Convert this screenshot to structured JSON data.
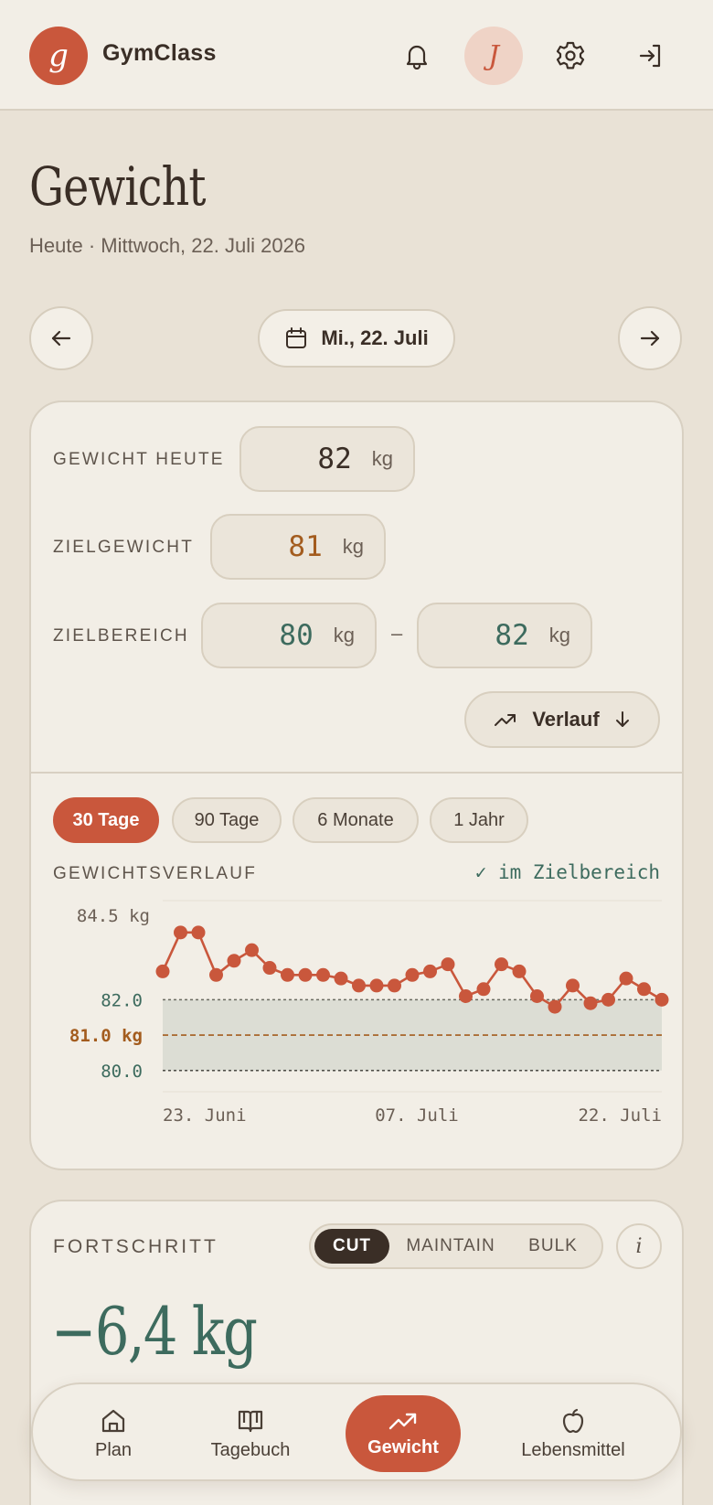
{
  "header": {
    "logo_letter": "g",
    "app_name": "GymClass",
    "avatar_letter": "J",
    "icons": [
      "bell-icon",
      "settings-icon",
      "logout-icon"
    ]
  },
  "page": {
    "title": "Gewicht",
    "subtitle": "Heute · Mittwoch, 22. Juli 2026",
    "date_pill": "Mi., 22. Juli"
  },
  "weight_form": {
    "today_label": "GEWICHT HEUTE",
    "today_value": "82",
    "goal_label": "ZIELGEWICHT",
    "goal_value": "81",
    "range_label": "ZIELBEREICH",
    "range_min": "80",
    "range_max": "82",
    "range_separator": "–",
    "unit": "kg",
    "history_button": "Verlauf"
  },
  "range_tabs": [
    "30 Tage",
    "90 Tage",
    "6 Monate",
    "1 Jahr"
  ],
  "chart_section": {
    "label": "GEWICHTSVERLAUF",
    "status": "✓ im Zielbereich"
  },
  "chart_data": {
    "type": "line",
    "y_top_label": "84.5 kg",
    "target_max_label": "82.0",
    "goal_label": "81.0 kg",
    "target_min_label": "80.0",
    "x_labels": [
      "23. Juni",
      "07. Juli",
      "22. Juli"
    ],
    "ylim": [
      79.4,
      84.8
    ],
    "target_range": [
      80.0,
      82.0
    ],
    "goal": 81.0,
    "values": [
      82.8,
      83.9,
      83.9,
      82.7,
      83.1,
      83.4,
      82.9,
      82.7,
      82.7,
      82.7,
      82.6,
      82.4,
      82.4,
      82.4,
      82.7,
      82.8,
      83.0,
      82.1,
      82.3,
      83.0,
      82.8,
      82.1,
      81.8,
      82.4,
      81.9,
      82.0,
      82.6,
      82.3,
      82.0
    ],
    "colors": {
      "line": "#c9573c",
      "band": "#dcddd4",
      "target": "#3d6b5e",
      "goal": "#a35c1e"
    }
  },
  "progress": {
    "label": "FORTSCHRITT",
    "modes": [
      "CUT",
      "MAINTAIN",
      "BULK"
    ],
    "active_mode": "CUT",
    "info": "i",
    "delta": "−6,4 kg"
  },
  "bottom_nav": [
    {
      "label": "Plan",
      "icon": "home-icon"
    },
    {
      "label": "Tagebuch",
      "icon": "book-icon"
    },
    {
      "label": "Gewicht",
      "icon": "trend-up-icon"
    },
    {
      "label": "Lebensmittel",
      "icon": "apple-icon"
    }
  ]
}
